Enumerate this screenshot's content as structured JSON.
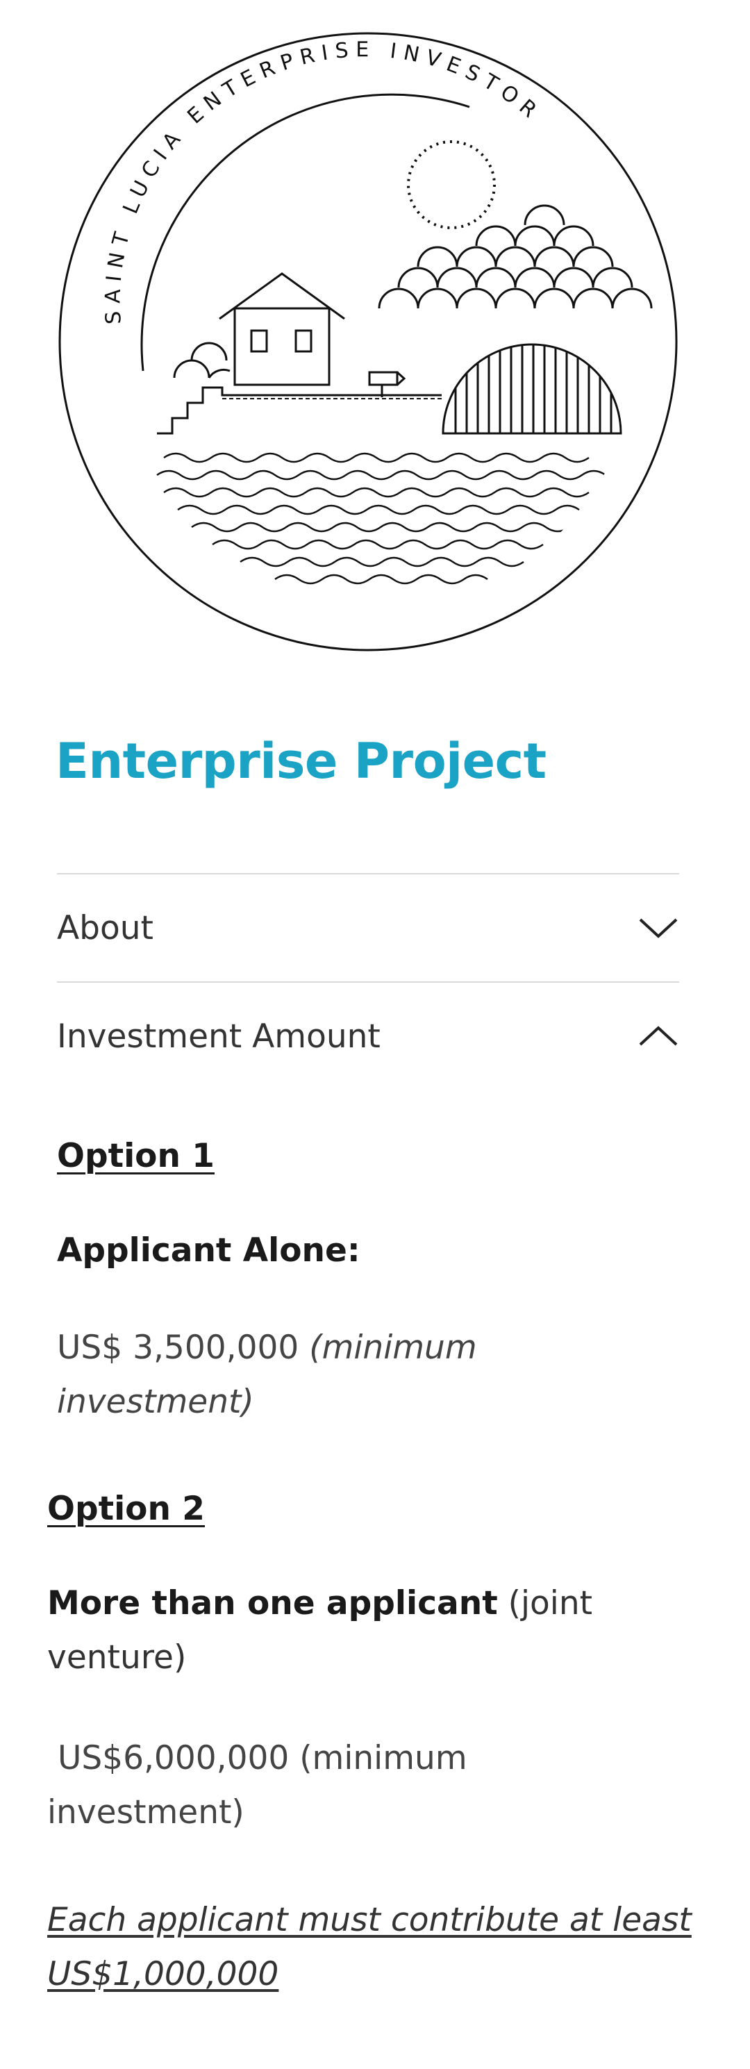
{
  "emblem": {
    "arc_text": "SAINT LUCIA ENTERPRISE INVESTOR",
    "icon": "saint-lucia-emblem"
  },
  "page": {
    "title": "Enterprise Project"
  },
  "accordion": {
    "items": [
      {
        "label": "About",
        "state": "collapsed",
        "icon": "chevron-down-icon"
      },
      {
        "label": "Investment Amount",
        "state": "expanded",
        "icon": "chevron-up-icon"
      }
    ]
  },
  "investment": {
    "option1": {
      "heading": "Option 1",
      "subheading": "Applicant Alone:",
      "amount": "US$ 3,500,000",
      "amount_note_line1": "(minimum",
      "amount_note_line2": "investment)"
    },
    "option2": {
      "heading": "Option 2",
      "subheading_bold": "More than one applicant",
      "subheading_rest_line1": "(joint",
      "subheading_rest_line2": "venture)",
      "amount_line1": " US$6,000,000 (minimum",
      "amount_line2": "investment)",
      "note_line1": "Each applicant must contribute at least",
      "note_line2": "US$1,000,000"
    }
  },
  "colors": {
    "title": "#1ba3c6",
    "divider": "#d9d9d9",
    "text": "#333333"
  }
}
